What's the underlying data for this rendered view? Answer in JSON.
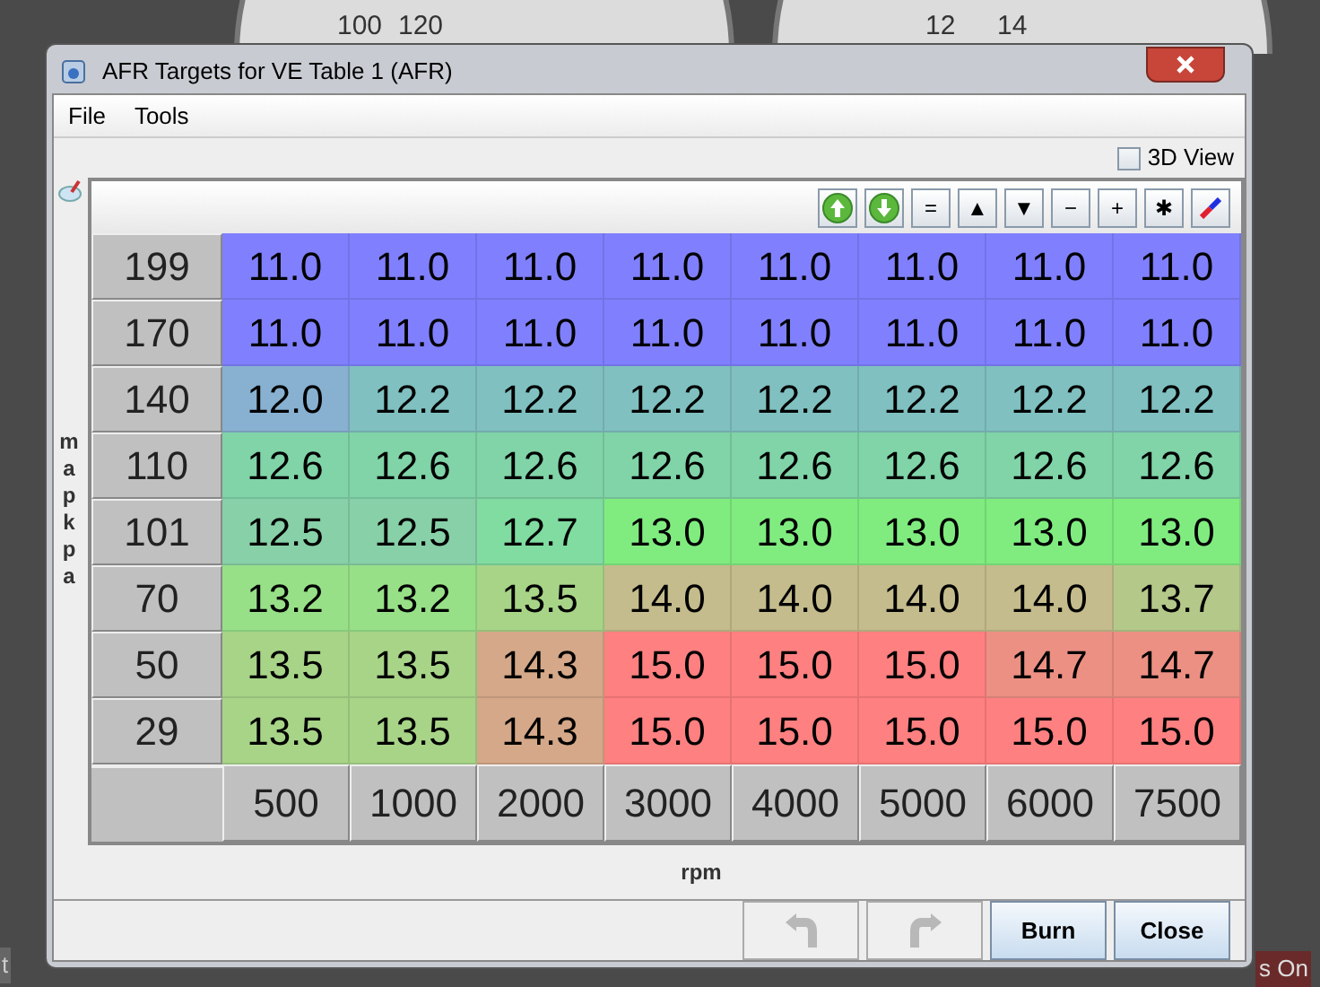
{
  "background": {
    "gauge_labels": [
      "100",
      "120",
      "12",
      "14"
    ],
    "edge_texts": [
      "t",
      "s On"
    ]
  },
  "window": {
    "title": "AFR Targets for VE Table 1 (AFR)"
  },
  "menu": [
    {
      "label": "File"
    },
    {
      "label": "Tools"
    }
  ],
  "view_3d": {
    "label": "3D View",
    "checked": false
  },
  "toolbar": [
    {
      "kind": "up"
    },
    {
      "kind": "down"
    },
    {
      "kind": "text",
      "label": "="
    },
    {
      "kind": "text",
      "label": "▲"
    },
    {
      "kind": "text",
      "label": "▼"
    },
    {
      "kind": "text",
      "label": "−"
    },
    {
      "kind": "text",
      "label": "+"
    },
    {
      "kind": "text",
      "label": "✱"
    },
    {
      "kind": "pen"
    }
  ],
  "y_axis": {
    "label": "map kpa"
  },
  "x_axis": {
    "label": "rpm",
    "values": [
      "500",
      "1000",
      "2000",
      "3000",
      "4000",
      "5000",
      "6000",
      "7500"
    ]
  },
  "rows": [
    {
      "load": "199",
      "cells": [
        {
          "value": "11.0",
          "color": "#8080ff"
        },
        {
          "value": "11.0",
          "color": "#8080ff"
        },
        {
          "value": "11.0",
          "color": "#8080ff"
        },
        {
          "value": "11.0",
          "color": "#8080ff"
        },
        {
          "value": "11.0",
          "color": "#8080ff"
        },
        {
          "value": "11.0",
          "color": "#8080ff"
        },
        {
          "value": "11.0",
          "color": "#8080ff"
        },
        {
          "value": "11.0",
          "color": "#8080ff"
        }
      ]
    },
    {
      "load": "170",
      "cells": [
        {
          "value": "11.0",
          "color": "#8080ff"
        },
        {
          "value": "11.0",
          "color": "#8080ff"
        },
        {
          "value": "11.0",
          "color": "#8080ff"
        },
        {
          "value": "11.0",
          "color": "#8080ff"
        },
        {
          "value": "11.0",
          "color": "#8080ff"
        },
        {
          "value": "11.0",
          "color": "#8080ff"
        },
        {
          "value": "11.0",
          "color": "#8080ff"
        },
        {
          "value": "11.0",
          "color": "#8080ff"
        }
      ]
    },
    {
      "load": "140",
      "cells": [
        {
          "value": "12.0",
          "color": "#88b0d0"
        },
        {
          "value": "12.2",
          "color": "#80c0c0"
        },
        {
          "value": "12.2",
          "color": "#80c0c0"
        },
        {
          "value": "12.2",
          "color": "#80c0c0"
        },
        {
          "value": "12.2",
          "color": "#80c0c0"
        },
        {
          "value": "12.2",
          "color": "#80c0c0"
        },
        {
          "value": "12.2",
          "color": "#80c0c0"
        },
        {
          "value": "12.2",
          "color": "#80c0c0"
        }
      ]
    },
    {
      "load": "110",
      "cells": [
        {
          "value": "12.6",
          "color": "#80d4a8"
        },
        {
          "value": "12.6",
          "color": "#80d4a8"
        },
        {
          "value": "12.6",
          "color": "#80d4a8"
        },
        {
          "value": "12.6",
          "color": "#80d4a8"
        },
        {
          "value": "12.6",
          "color": "#80d4a8"
        },
        {
          "value": "12.6",
          "color": "#80d4a8"
        },
        {
          "value": "12.6",
          "color": "#80d4a8"
        },
        {
          "value": "12.6",
          "color": "#80d4a8"
        }
      ]
    },
    {
      "load": "101",
      "cells": [
        {
          "value": "12.5",
          "color": "#88d0a8"
        },
        {
          "value": "12.5",
          "color": "#88d0a8"
        },
        {
          "value": "12.7",
          "color": "#80dca0"
        },
        {
          "value": "13.0",
          "color": "#80ec80"
        },
        {
          "value": "13.0",
          "color": "#80ec80"
        },
        {
          "value": "13.0",
          "color": "#80ec80"
        },
        {
          "value": "13.0",
          "color": "#80ec80"
        },
        {
          "value": "13.0",
          "color": "#80ec80"
        }
      ]
    },
    {
      "load": "70",
      "cells": [
        {
          "value": "13.2",
          "color": "#98e088"
        },
        {
          "value": "13.2",
          "color": "#98e088"
        },
        {
          "value": "13.5",
          "color": "#a8d488"
        },
        {
          "value": "14.0",
          "color": "#c4bc8c"
        },
        {
          "value": "14.0",
          "color": "#c4bc8c"
        },
        {
          "value": "14.0",
          "color": "#c4bc8c"
        },
        {
          "value": "14.0",
          "color": "#c4bc8c"
        },
        {
          "value": "13.7",
          "color": "#b4c88a"
        }
      ]
    },
    {
      "load": "50",
      "cells": [
        {
          "value": "13.5",
          "color": "#a8d488"
        },
        {
          "value": "13.5",
          "color": "#a8d488"
        },
        {
          "value": "14.3",
          "color": "#d4a888"
        },
        {
          "value": "15.0",
          "color": "#ff8080"
        },
        {
          "value": "15.0",
          "color": "#ff8080"
        },
        {
          "value": "15.0",
          "color": "#ff8080"
        },
        {
          "value": "14.7",
          "color": "#ec9084"
        },
        {
          "value": "14.7",
          "color": "#ec9084"
        }
      ]
    },
    {
      "load": "29",
      "cells": [
        {
          "value": "13.5",
          "color": "#a8d488"
        },
        {
          "value": "13.5",
          "color": "#a8d488"
        },
        {
          "value": "14.3",
          "color": "#d4a888"
        },
        {
          "value": "15.0",
          "color": "#ff8080"
        },
        {
          "value": "15.0",
          "color": "#ff8080"
        },
        {
          "value": "15.0",
          "color": "#ff8080"
        },
        {
          "value": "15.0",
          "color": "#ff8080"
        },
        {
          "value": "15.0",
          "color": "#ff8080"
        }
      ]
    }
  ],
  "buttons": [
    {
      "kind": "undo",
      "disabled": true
    },
    {
      "kind": "redo",
      "disabled": true
    },
    {
      "kind": "text",
      "label": "Burn",
      "disabled": false
    },
    {
      "kind": "text",
      "label": "Close",
      "disabled": false
    }
  ]
}
